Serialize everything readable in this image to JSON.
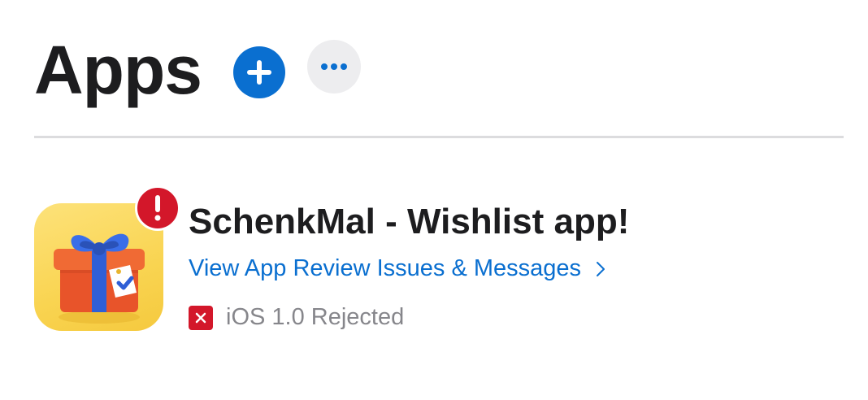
{
  "header": {
    "title": "Apps",
    "add_icon": "plus-icon",
    "more_icon": "ellipsis-icon"
  },
  "colors": {
    "accent": "#0a6fd0",
    "alert": "#d3172a",
    "secondary_text": "#86868b"
  },
  "app": {
    "name": "SchenkMal - Wishlist app!",
    "icon": "gift-icon",
    "alert_icon": "exclamation-icon",
    "review_link": "View App Review Issues & Messages",
    "status_icon": "rejected-x-icon",
    "status": "iOS 1.0 Rejected"
  }
}
